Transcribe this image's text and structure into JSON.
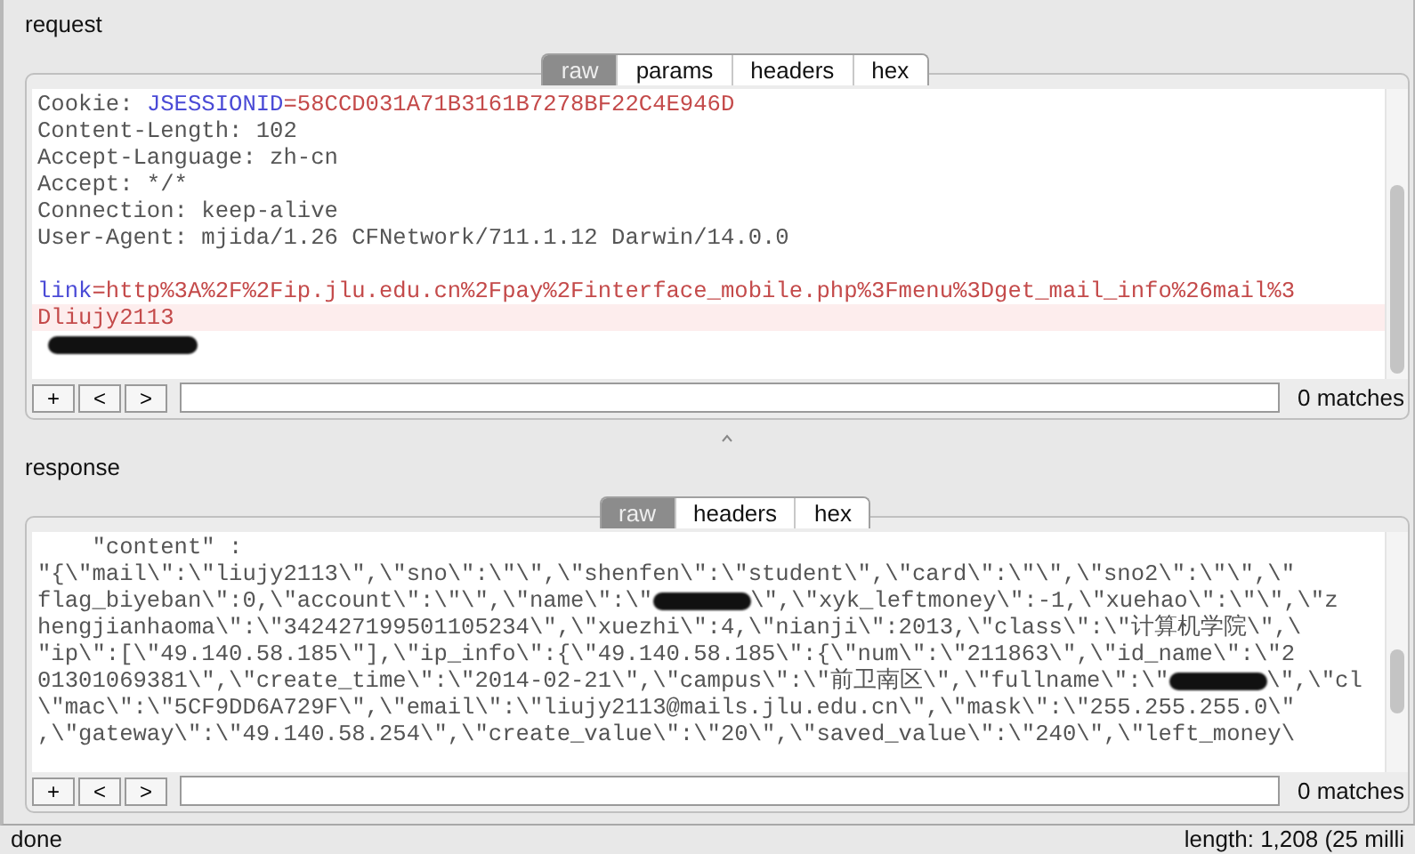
{
  "request": {
    "title": "request",
    "tabs": [
      {
        "label": "raw",
        "selected": true
      },
      {
        "label": "params",
        "selected": false
      },
      {
        "label": "headers",
        "selected": false
      },
      {
        "label": "hex",
        "selected": false
      }
    ],
    "lines": [
      {
        "kind": "code",
        "highlighted": false,
        "segments": [
          {
            "kind": "plain",
            "text": "Cookie: "
          },
          {
            "kind": "name",
            "text": "JSESSIONID"
          },
          {
            "kind": "value",
            "text": "=58CCD031A71B3161B7278BF22C4E946D"
          }
        ]
      },
      {
        "kind": "code",
        "highlighted": false,
        "segments": [
          {
            "kind": "plain",
            "text": "Content-Length: 102"
          }
        ]
      },
      {
        "kind": "code",
        "highlighted": false,
        "segments": [
          {
            "kind": "plain",
            "text": "Accept-Language: zh-cn"
          }
        ]
      },
      {
        "kind": "code",
        "highlighted": false,
        "segments": [
          {
            "kind": "plain",
            "text": "Accept: */*"
          }
        ]
      },
      {
        "kind": "code",
        "highlighted": false,
        "segments": [
          {
            "kind": "plain",
            "text": "Connection: keep-alive"
          }
        ]
      },
      {
        "kind": "code",
        "highlighted": false,
        "segments": [
          {
            "kind": "plain",
            "text": "User-Agent: mjida/1.26 CFNetwork/711.1.12 Darwin/14.0.0"
          }
        ]
      },
      {
        "kind": "blank"
      },
      {
        "kind": "code",
        "highlighted": false,
        "segments": [
          {
            "kind": "name",
            "text": "link"
          },
          {
            "kind": "value",
            "text": "=http%3A%2F%2Fip.jlu.edu.cn%2Fpay%2Finterface_mobile.php%3Fmenu%3Dget_mail_info%26mail%3"
          }
        ]
      },
      {
        "kind": "code",
        "highlighted": true,
        "segments": [
          {
            "kind": "value",
            "text": "Dliujy2113"
          }
        ]
      },
      {
        "kind": "redacted"
      }
    ],
    "search": {
      "buttons": [
        "+",
        "<",
        ">"
      ],
      "matches": "0 matches"
    }
  },
  "response": {
    "title": "response",
    "tabs": [
      {
        "label": "raw",
        "selected": true
      },
      {
        "label": "headers",
        "selected": false
      },
      {
        "label": "hex",
        "selected": false
      }
    ],
    "lines": [
      {
        "kind": "code",
        "highlighted": false,
        "segments": [
          {
            "kind": "plain",
            "text": "    \"content\" :"
          }
        ]
      },
      {
        "kind": "code",
        "highlighted": false,
        "segments": [
          {
            "kind": "plain",
            "text": "\"{\\\"mail\\\":\\\"liujy2113\\\",\\\"sno\\\":\\\"\\\",\\\"shenfen\\\":\\\"student\\\",\\\"card\\\":\\\"\\\",\\\"sno2\\\":\\\"\\\",\\\""
          }
        ]
      },
      {
        "kind": "code",
        "highlighted": false,
        "segments": [
          {
            "kind": "plain",
            "text": "flag_biyeban\\\":0,\\\"account\\\":\\\"\\\",\\\"name\\\":\\\""
          },
          {
            "kind": "redacted"
          },
          {
            "kind": "plain",
            "text": "\\\",\\\"xyk_leftmoney\\\":-1,\\\"xuehao\\\":\\\"\\\",\\\"z"
          }
        ]
      },
      {
        "kind": "code",
        "highlighted": false,
        "segments": [
          {
            "kind": "plain",
            "text": "hengjianhaoma\\\":\\\"342427199501105234\\\",\\\"xuezhi\\\":4,\\\"nianji\\\":2013,\\\"class\\\":\\\"计算机学院\\\",\\"
          }
        ]
      },
      {
        "kind": "code",
        "highlighted": false,
        "segments": [
          {
            "kind": "plain",
            "text": "\"ip\\\":[\\\"49.140.58.185\\\"],\\\"ip_info\\\":{\\\"49.140.58.185\\\":{\\\"num\\\":\\\"211863\\\",\\\"id_name\\\":\\\"2"
          }
        ]
      },
      {
        "kind": "code",
        "highlighted": false,
        "segments": [
          {
            "kind": "plain",
            "text": "01301069381\\\",\\\"create_time\\\":\\\"2014-02-21\\\",\\\"campus\\\":\\\"前卫南区\\\",\\\"fullname\\\":\\\""
          },
          {
            "kind": "redacted"
          },
          {
            "kind": "plain",
            "text": "\\\",\\\"cl"
          }
        ]
      },
      {
        "kind": "code",
        "highlighted": false,
        "segments": [
          {
            "kind": "plain",
            "text": "\\\"mac\\\":\\\"5CF9DD6A729F\\\",\\\"email\\\":\\\"liujy2113@mails.jlu.edu.cn\\\",\\\"mask\\\":\\\"255.255.255.0\\\""
          }
        ]
      },
      {
        "kind": "code",
        "highlighted": false,
        "segments": [
          {
            "kind": "plain",
            "text": ",\\\"gateway\\\":\\\"49.140.58.254\\\",\\\"create_value\\\":\\\"20\\\",\\\"saved_value\\\":\\\"240\\\",\\\"left_money\\"
          }
        ]
      }
    ],
    "search": {
      "buttons": [
        "+",
        "<",
        ">"
      ],
      "matches": "0 matches"
    }
  },
  "status_bar": {
    "left": "done",
    "right": "length: 1,208 (25 milli"
  }
}
